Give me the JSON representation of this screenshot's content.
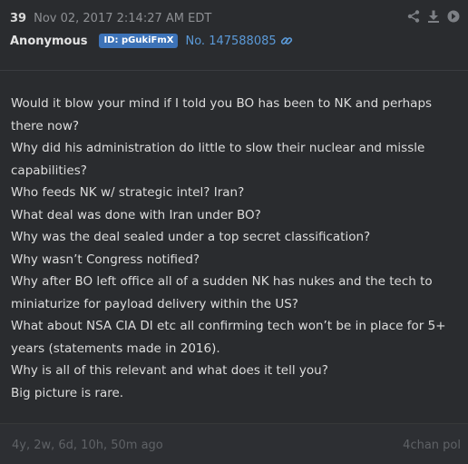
{
  "post": {
    "number": "39",
    "timestamp": "Nov 02, 2017 2:14:27 AM EDT",
    "author": "Anonymous",
    "id_badge": "ID: pGukiFmX",
    "post_no": "No. 147588085",
    "actions": [
      "share-icon",
      "download-icon",
      "go-icon"
    ],
    "lines": [
      "Would it blow your mind if I told you BO has been to NK and perhaps there now?",
      "Why did his administration do little to slow their nuclear and missle capabilities?",
      "Who feeds NK w/ strategic intel? Iran?",
      "What deal was done with Iran under BO?",
      "Why was the deal sealed under a top secret classification?",
      "Why wasn’t Congress notified?",
      "Why after BO left office all of a sudden NK has nukes and the tech to miniaturize for payload delivery within the US?",
      "What about NSA CIA DI etc all confirming tech won’t be in place for 5+ years (statements made in 2016).",
      "Why is all of this relevant and what does it tell you?",
      "Big picture is rare."
    ],
    "age": "4y, 2w, 6d, 10h, 50m ago",
    "source": "4chan pol"
  },
  "colors": {
    "background": "#2a2c2f",
    "badge": "#3d73b8",
    "link": "#5b9ad8",
    "text": "#dcdcdc",
    "muted": "#5f6266"
  }
}
